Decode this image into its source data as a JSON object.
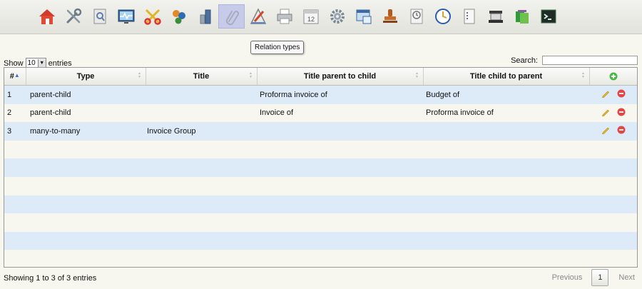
{
  "toolbar": {
    "icons": [
      "home-icon",
      "tools-icon",
      "search-document-icon",
      "monitor-chart-icon",
      "scissors-icon",
      "users-icon",
      "bottles-icon",
      "paperclip-icon",
      "draw-tools-icon",
      "printer-icon",
      "calendar-icon",
      "gear-icon",
      "window-icon",
      "stamp-icon",
      "clipboard-icon",
      "clock-icon",
      "list-icon",
      "scanner-icon",
      "folders-icon",
      "terminal-icon"
    ],
    "calendar_day": "12",
    "active_tooltip": "Relation types"
  },
  "controls": {
    "show_label": "Show",
    "page_length": "10",
    "entries_label": "entries",
    "search_label": "Search:",
    "search_value": ""
  },
  "table": {
    "columns": [
      "#",
      "Type",
      "Title",
      "Title parent to child",
      "Title child to parent"
    ],
    "rows": [
      {
        "id": "1",
        "type": "parent-child",
        "title": "",
        "parent_to_child": "Proforma invoice of",
        "child_to_parent": "Budget of"
      },
      {
        "id": "2",
        "type": "parent-child",
        "title": "",
        "parent_to_child": "Invoice of",
        "child_to_parent": "Proforma invoice of"
      },
      {
        "id": "3",
        "type": "many-to-many",
        "title": "Invoice Group",
        "parent_to_child": "",
        "child_to_parent": ""
      }
    ]
  },
  "footer": {
    "info": "Showing 1 to 3 of 3 entries",
    "previous": "Previous",
    "current_page": "1",
    "next": "Next"
  },
  "colors": {
    "row_stripe": "#ddeaf8",
    "row_plain": "#f7f6ef",
    "active_toolbar": "#c7cbe9",
    "add_green": "#4cb848",
    "delete_red": "#e04848",
    "edit_yellow": "#e8b82c"
  }
}
